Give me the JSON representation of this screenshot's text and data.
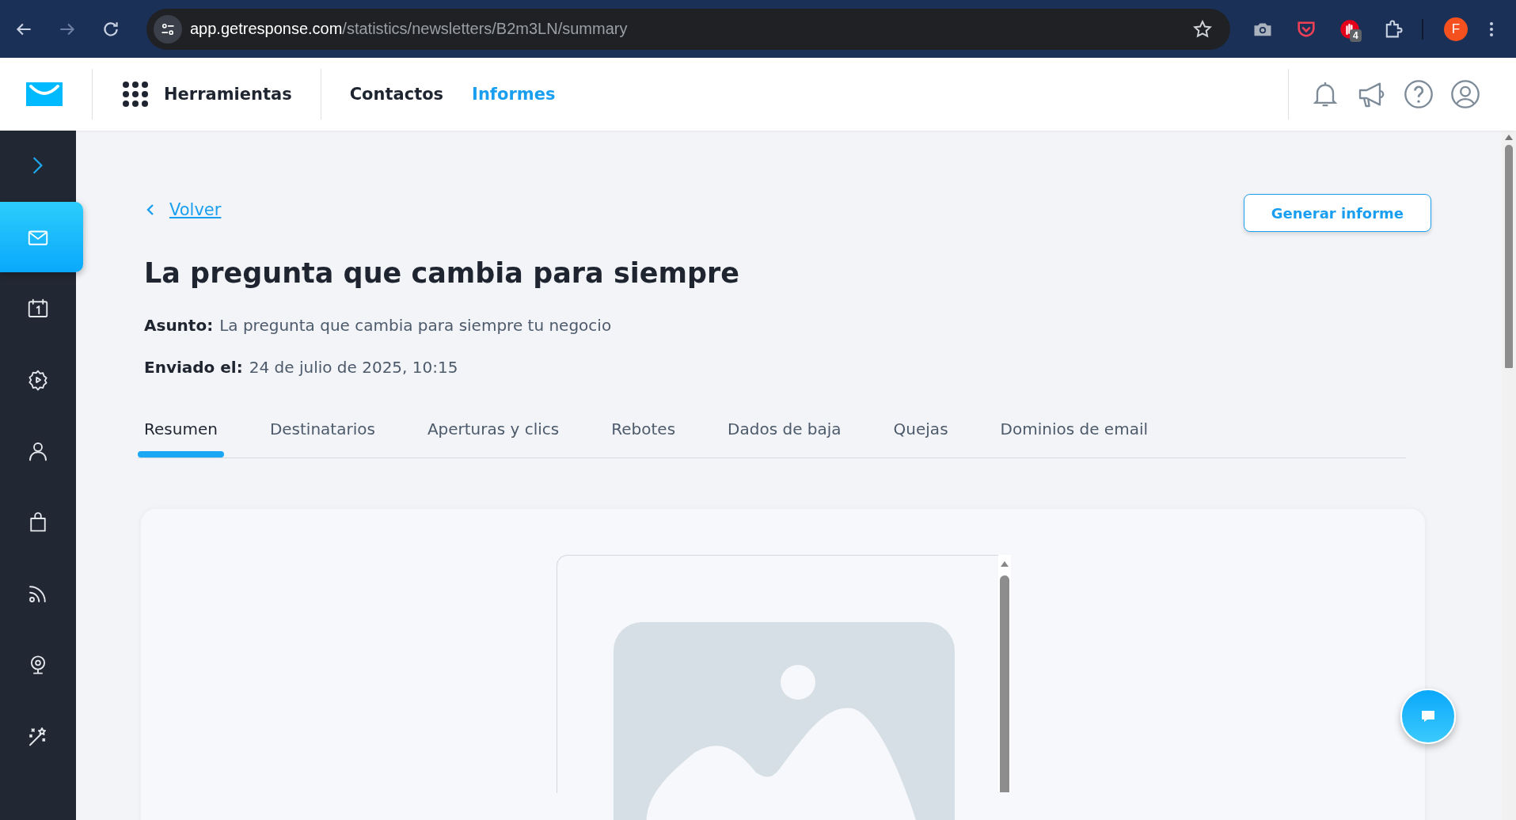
{
  "browser": {
    "url_host": "app.getresponse.com",
    "url_path": "/statistics/newsletters/B2m3LN/summary",
    "extension_badge": "4",
    "profile_initial": "F"
  },
  "top_nav": {
    "tools_label": "Herramientas",
    "links": [
      {
        "label": "Contactos",
        "selected": false
      },
      {
        "label": "Informes",
        "selected": true
      }
    ]
  },
  "sidebar": {
    "items": [
      {
        "selected": true
      },
      {
        "selected": false
      },
      {
        "selected": false
      },
      {
        "selected": false
      },
      {
        "selected": false
      },
      {
        "selected": false
      },
      {
        "selected": false
      },
      {
        "selected": false
      }
    ]
  },
  "back_link": "Volver",
  "generate_button": "Generar informe",
  "title": "La pregunta que cambia para siempre",
  "meta": [
    {
      "label": "Asunto:",
      "value": "La pregunta que cambia para siempre tu negocio"
    },
    {
      "label": "Enviado el:",
      "value": "24 de julio de 2025, 10:15"
    }
  ],
  "tabs": [
    {
      "label": "Resumen",
      "selected": true
    },
    {
      "label": "Destinatarios",
      "selected": false
    },
    {
      "label": "Aperturas y clics",
      "selected": false
    },
    {
      "label": "Rebotes",
      "selected": false
    },
    {
      "label": "Dados de baja",
      "selected": false
    },
    {
      "label": "Quejas",
      "selected": false
    },
    {
      "label": "Dominios de email",
      "selected": false
    }
  ]
}
